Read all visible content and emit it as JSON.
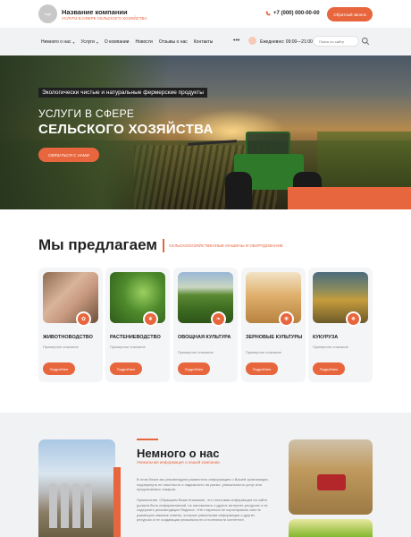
{
  "header": {
    "logo_text": "logo",
    "company_name": "Название компании",
    "company_tagline": "УСЛУГИ В СФЕРЕ СЕЛЬСКОГО ХОЗЯЙСТВА",
    "phone": "+7 (000) 000-00-00",
    "callback_label": "Обратный звонок"
  },
  "nav": {
    "items": [
      {
        "label": "Немного о нас",
        "caret": "▾"
      },
      {
        "label": "Услуги",
        "caret": "▾"
      },
      {
        "label": "О компании",
        "caret": ""
      },
      {
        "label": "Новости",
        "caret": ""
      },
      {
        "label": "Отзывы о нас",
        "caret": ""
      },
      {
        "label": "Контакты",
        "caret": ""
      }
    ],
    "more": "•••",
    "hours": "Ежедневно: 09:00—21:00",
    "search_placeholder": "Поиск по сайту"
  },
  "hero": {
    "tag": "Экологически чистые и натуральные фермерские продукты",
    "title_line1": "УСЛУГИ В СФЕРЕ",
    "title_line2": "СЕЛЬСКОГО ХОЗЯЙСТВА",
    "button": "СВЯЗАТЬСЯ С НАМИ"
  },
  "offer": {
    "title": "Мы предлагаем",
    "subtitle": "СЕЛЬСКОХОЗЯЙСТВЕННЫЕ МАШИНЫ И ОБОРУДОВАНИЕ",
    "cards": [
      {
        "title": "ЖИВОТНОВОДСТВО",
        "desc": "Примерное описание",
        "button": "Подробнее",
        "icon": "pig-icon"
      },
      {
        "title": "РАСТЕНИЕВОДСТВО",
        "desc": "Примерное описание",
        "button": "Подробнее",
        "icon": "seedling-icon"
      },
      {
        "title": "ОВОЩНАЯ КУЛЬТУРА",
        "desc": "Примерное описание",
        "button": "Подробнее",
        "icon": "vegetable-icon"
      },
      {
        "title": "ЗЕРНОВЫЕ КУЛЬТУРЫ",
        "desc": "Примерное описание",
        "button": "Подробнее",
        "icon": "wheat-icon"
      },
      {
        "title": "КУКУРУЗА",
        "desc": "Примерное описание",
        "button": "Подробнее",
        "icon": "corn-icon"
      }
    ]
  },
  "about": {
    "title": "Немного о нас",
    "subtitle": "Уникальная информация о нашей компании",
    "paragraph1": "В этом блоке мы рекомендуем разместить информацию о Вашей организации, подчеркнуть ее опытность и надежность на рынке, уникальность услуг или предлагаемых товаров.",
    "paragraph2": "Примечание. Обращаем Ваше внимание, что текстовая информация на сайте должна быть информативной, не напоминать о других интернет-ресурсах и не содержать рекомендации Яндекса. «Не стараться не коротировать или не размещать важные советы, которые уникальная информация о других ресурсах и не создающая уникальности и полезности контента»."
  }
}
